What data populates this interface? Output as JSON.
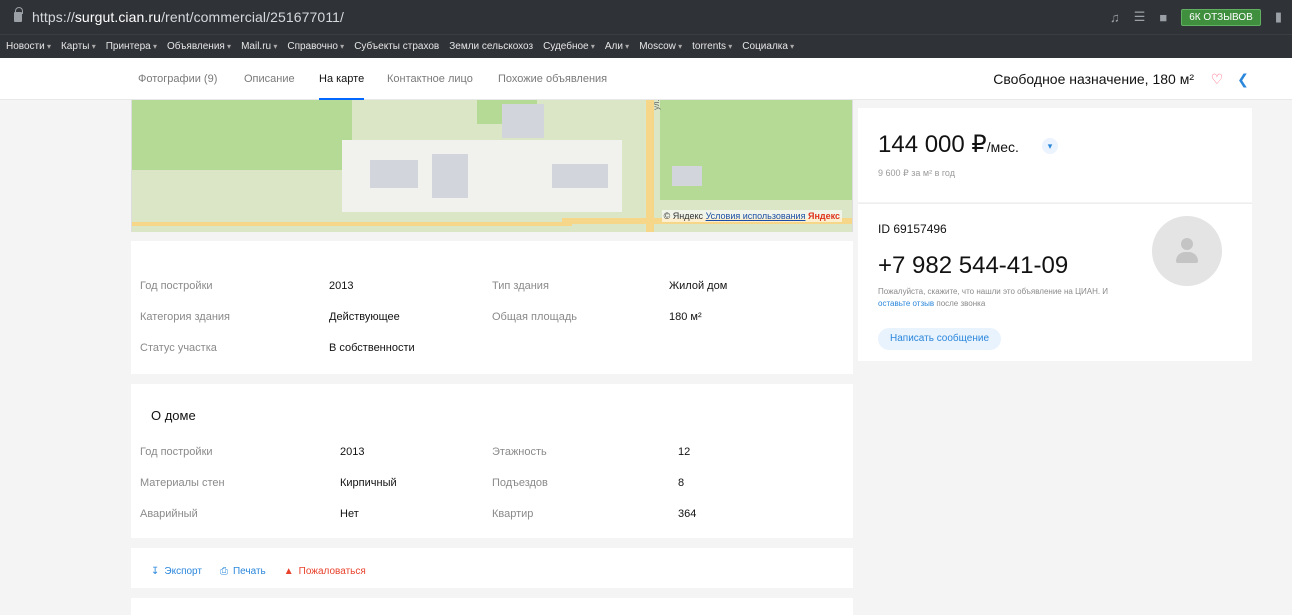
{
  "browser": {
    "url_prefix": "https://",
    "url_domain": "surgut.cian.ru",
    "url_path": "/rent/commercial/251677011/",
    "reviews_label": "6К ОТЗЫВОВ",
    "bookmarks": [
      "Новости",
      "Карты",
      "Принтера",
      "Объявления",
      "Mail.ru",
      "Справочно",
      "Субъекты страхов",
      "Земли сельскохоз",
      "Судебное",
      "Али",
      "Moscow",
      "torrents",
      "Социалка"
    ]
  },
  "tabs": {
    "photos": "Фотографии (9)",
    "description": "Описание",
    "map": "На карте",
    "contact": "Контактное лицо",
    "similar": "Похожие объявления"
  },
  "summary": "Свободное назначение, 180 м²",
  "map": {
    "street": "ул.",
    "copyright": "© Яндекс",
    "terms": "Условия использования",
    "brand": "Яндекс"
  },
  "building": {
    "year_label": "Год постройки",
    "year_value": "2013",
    "category_label": "Категория здания",
    "category_value": "Действующее",
    "status_label": "Статус участка",
    "status_value": "В собственности",
    "type_label": "Тип здания",
    "type_value": "Жилой дом",
    "area_label": "Общая площадь",
    "area_value": "180 м²"
  },
  "house": {
    "title": "О доме",
    "year_label": "Год постройки",
    "year_value": "2013",
    "walls_label": "Материалы стен",
    "walls_value": "Кирпичный",
    "emergency_label": "Аварийный",
    "emergency_value": "Нет",
    "floors_label": "Этажность",
    "floors_value": "12",
    "entrances_label": "Подъездов",
    "entrances_value": "8",
    "flats_label": "Квартир",
    "flats_value": "364"
  },
  "actions": {
    "export": "Экспорт",
    "print": "Печать",
    "complain": "Пожаловаться"
  },
  "price": {
    "amount": "144 000 ₽",
    "unit": "/мес.",
    "per_meter": "9 600 ₽ за м² в год"
  },
  "contact": {
    "id": "ID 69157496",
    "phone": "+7 982 544-41-09",
    "note_text": "Пожалуйста, скажите, что нашли это объявление на ЦИАН. И",
    "note_link": "оставьте отзыв",
    "note_tail": "после звонка",
    "message_button": "Написать сообщение"
  },
  "colors": {
    "accent": "#0468ff",
    "link": "#2b87db",
    "warn": "#e8422c",
    "heart": "#ff5f7e"
  }
}
